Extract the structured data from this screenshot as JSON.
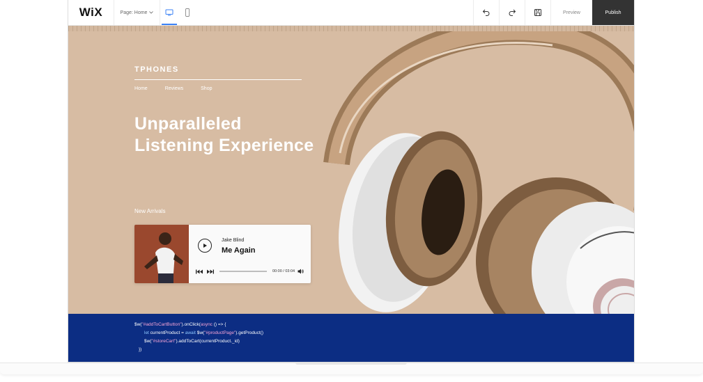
{
  "toolbar": {
    "logo": "WiX",
    "page_select": "Page: Home",
    "preview": "Preview",
    "publish": "Publish"
  },
  "hero": {
    "brand": "TPHONES",
    "nav": [
      "Home",
      "Reviews",
      "Shop"
    ],
    "headline_line1": "Unparalleled",
    "headline_line2": "Listening Experience",
    "new_arrivals": "New Arrivals"
  },
  "player": {
    "artist": "Jake Blind",
    "song": "Me Again",
    "time": "00:00 / 03:04",
    "progress": 0
  },
  "code": {
    "line1_a": "$w(",
    "line1_b": "\"#addToCartButton\"",
    "line1_c": ").onClick(",
    "line1_d": "async",
    "line1_e": " () => {",
    "line2_a": "let",
    "line2_b": " currentProduct = ",
    "line2_c": "await",
    "line2_d": " $w(",
    "line2_e": "\"#productPage\"",
    "line2_f": ").getProduct()",
    "line3_a": "$w(",
    "line3_b": "\"#storeCart\"",
    "line3_c": ").addToCart(currentProduct._id)",
    "line4": "})"
  },
  "colors": {
    "hero_bg": "#d7bca3",
    "code_bg": "#0c2d83",
    "publish_bg": "#333333",
    "accent": "#3b82f6"
  },
  "icons": {
    "desktop": "desktop-icon",
    "mobile": "mobile-icon",
    "undo": "undo-icon",
    "redo": "redo-icon",
    "save": "save-icon",
    "play": "play-icon",
    "prev": "previous-track-icon",
    "next": "next-track-icon",
    "volume": "volume-icon"
  }
}
